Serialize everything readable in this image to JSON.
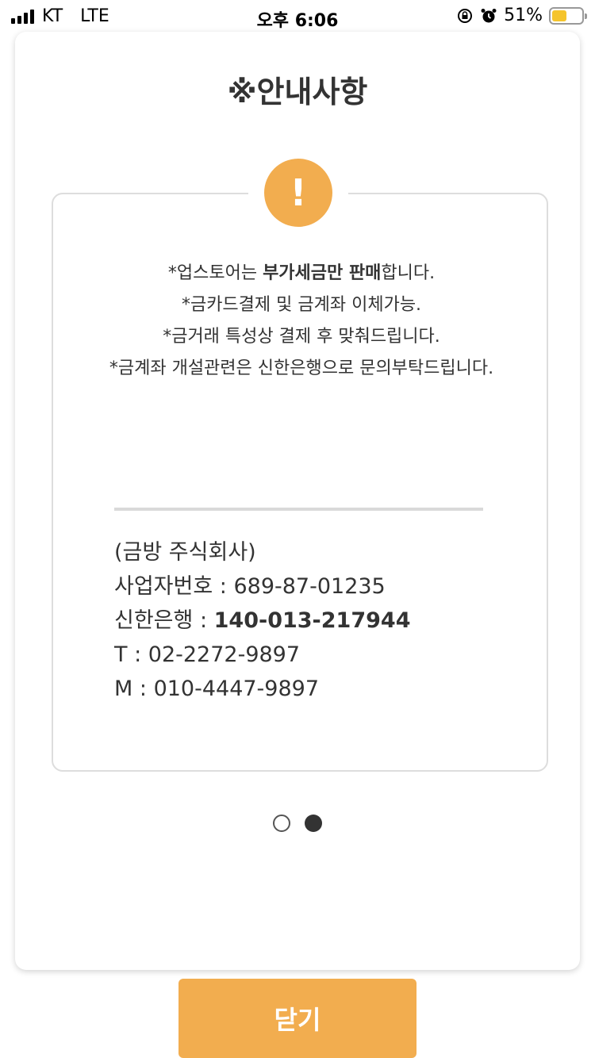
{
  "status_bar": {
    "carrier": "KT",
    "network": "LTE",
    "time": "오후 6:06",
    "battery_percent": "51%",
    "battery_level": 0.51,
    "icons": [
      "rotation-lock-icon",
      "alarm-icon"
    ]
  },
  "modal": {
    "title": "※안내사항",
    "badge": "!",
    "notice": {
      "line1_prefix": "*업스토어는 ",
      "line1_bold": "부가세금만 판매",
      "line1_suffix": "합니다.",
      "line2": "*금카드결제 및 금계좌 이체가능.",
      "line3": "*금거래 특성상 결제 후 맞춰드립니다.",
      "line4": "*금계좌 개설관련은 신한은행으로 문의부탁드립니다."
    },
    "company": {
      "name": "(금방 주식회사)",
      "biz_label": "사업자번호 : ",
      "biz_number": "689-87-01235",
      "bank_label": "신한은행 : ",
      "bank_account": "140-013-217944",
      "tel_label": "T : ",
      "tel": "02-2272-9897",
      "mobile_label": "M : ",
      "mobile": "010-4447-9897"
    },
    "pager": {
      "total": 2,
      "current": 2
    }
  },
  "close_button": "닫기",
  "colors": {
    "accent": "#f2ad4f",
    "text": "#333333",
    "border": "#dddddd"
  }
}
